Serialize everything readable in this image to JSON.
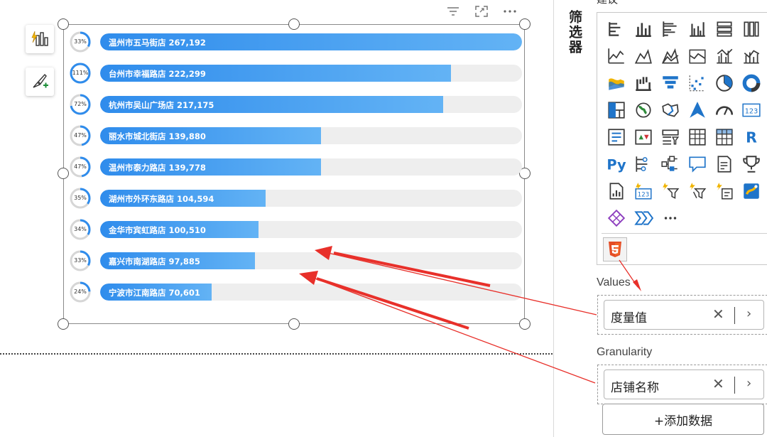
{
  "toolbar": {
    "build_icon": "build-visual-icon",
    "format_icon": "format-visual-icon"
  },
  "visual": {
    "header_icons": [
      "filter-icon",
      "focus-mode-icon",
      "more-options-icon"
    ],
    "bar_color_start": "#2f8cec",
    "bar_color_end": "#63b3f5",
    "track_color": "#eeeeee",
    "rows": [
      {
        "label": "温州市五马街店 267,192",
        "pct": "33%",
        "value": 267192
      },
      {
        "label": "台州市幸福路店 222,299",
        "pct": "111%",
        "value": 222299
      },
      {
        "label": "杭州市吴山广场店 217,175",
        "pct": "72%",
        "value": 217175
      },
      {
        "label": "丽水市城北街店 139,880",
        "pct": "47%",
        "value": 139880
      },
      {
        "label": "温州市泰力路店 139,778",
        "pct": "47%",
        "value": 139778
      },
      {
        "label": "湖州市外环东路店 104,594",
        "pct": "35%",
        "value": 104594
      },
      {
        "label": "金华市宾虹路店 100,510",
        "pct": "34%",
        "value": 100510
      },
      {
        "label": "嘉兴市南湖路店 97,885",
        "pct": "33%",
        "value": 97885
      },
      {
        "label": "宁波市江南路店 70,601",
        "pct": "24%",
        "value": 70601
      }
    ]
  },
  "filters_label": "筛选器",
  "build_label": "建议",
  "visualizations": {
    "icons": [
      "stacked-bar-icon",
      "stacked-column-icon",
      "clustered-bar-icon",
      "clustered-column-icon",
      "100-stacked-bar-icon",
      "100-stacked-column-icon",
      "line-chart-icon",
      "area-chart-icon",
      "stacked-area-icon",
      "ribbon-chart-icon",
      "line-clustered-column-icon",
      "line-stacked-column-icon",
      "ribbon-icon",
      "waterfall-icon",
      "funnel-icon",
      "scatter-icon",
      "pie-chart-icon",
      "donut-chart-icon",
      "treemap-icon",
      "map-icon",
      "filled-map-icon",
      "azure-map-icon",
      "gauge-icon",
      "card-icon",
      "multi-row-card-icon",
      "kpi-icon",
      "slicer-icon",
      "table-icon",
      "matrix-icon",
      "r-script-icon",
      "python-icon",
      "key-influencers-icon",
      "decomposition-tree-icon",
      "qa-icon",
      "smart-narrative-icon",
      "goals-icon",
      "paginated-report-icon",
      "power-kpi-icon",
      "power-automate-icon",
      "power-apps-icon",
      "power-bi-flow-icon",
      "arcgis-icon",
      "custom-visual-a-icon",
      "custom-visual-b-icon",
      "more-visuals-icon"
    ],
    "selected_custom_icon": "html5-icon",
    "accent": "#e44d26"
  },
  "values_section": {
    "title": "Values",
    "field": "度量值"
  },
  "granularity_section": {
    "title": "Granularity",
    "field": "店铺名称"
  },
  "add_data_label": "+添加数据",
  "annotation_color": "#e8302a"
}
